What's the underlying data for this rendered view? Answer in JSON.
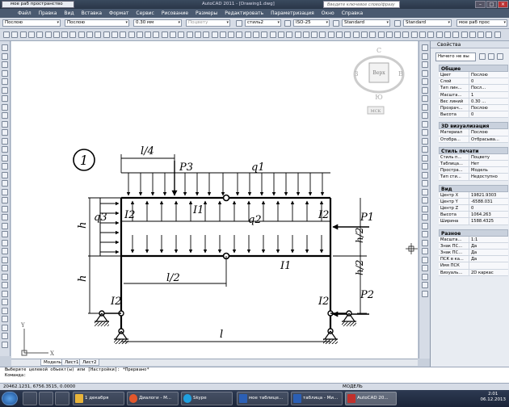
{
  "titlebar": {
    "workspace": "мое раб пространство",
    "title": "AutoCAD 2011 - [Drawing1.dwg]",
    "search_placeholder": "Введите ключевое слово/фразу"
  },
  "menu": [
    "Файл",
    "Правка",
    "Вид",
    "Вставка",
    "Формат",
    "Сервис",
    "Рисование",
    "Размеры",
    "Редактировать",
    "Параметризация",
    "Окно",
    "Справка"
  ],
  "toolbar1": {
    "color": "Послою",
    "linetype": "Послою",
    "lineweight": "0.30 мм",
    "plotstyle": "Поцвету",
    "textstyle": "стиль2",
    "dimstyle": "ISO-25",
    "tablestyle": "Standard",
    "mleaderstyle": "Standard",
    "workspace2": "мое раб прос"
  },
  "viewcube": {
    "north": "С",
    "south": "Ю",
    "west": "З",
    "east": "В",
    "top": "Верх",
    "ucs": "МСК"
  },
  "drawing": {
    "number": "1",
    "label_l4": "l/4",
    "label_P3": "P3",
    "label_q1": "q1",
    "label_q2": "q2",
    "label_q3": "q3",
    "label_I1a": "I1",
    "label_I1b": "I1",
    "label_I2tl": "I2",
    "label_I2tr": "I2",
    "label_I2bl": "I2",
    "label_I2br": "I2",
    "label_P1": "P1",
    "label_P2": "P2",
    "label_h1": "h",
    "label_h2": "h",
    "label_h2a": "h/2",
    "label_h2b": "h/2",
    "label_l2": "l/2",
    "label_l": "l",
    "axis_y": "Y",
    "axis_x": "X"
  },
  "tabs": [
    "Модель",
    "Лист1",
    "Лист2"
  ],
  "command": {
    "line1": "Выберите целевой объект(ы) или [Настройки]: *Прервано*",
    "line2": "Команда:"
  },
  "status": {
    "coords": "20462.1231, 6756.3515, 0.0000",
    "model": "МОДЕЛЬ"
  },
  "properties": {
    "header": "Свойства",
    "selection": "Ничего не вы",
    "sections": [
      {
        "title": "Общие",
        "rows": [
          [
            "Цвет",
            "Послою"
          ],
          [
            "Слой",
            "0"
          ],
          [
            "Тип лин...",
            "Посл..."
          ],
          [
            "Масшта...",
            "1"
          ],
          [
            "Вес линий",
            "0.30 ..."
          ],
          [
            "Прозрач...",
            "Послою"
          ],
          [
            "Высота",
            "0"
          ]
        ]
      },
      {
        "title": "3D визуализация",
        "rows": [
          [
            "Материал",
            "Послою"
          ],
          [
            "Отобра...",
            "Отбрасыва..."
          ]
        ]
      },
      {
        "title": "Стиль печати",
        "rows": [
          [
            "Стиль п...",
            "Поцвету"
          ],
          [
            "Таблица...",
            "Нет"
          ],
          [
            "Простра...",
            "Модель"
          ],
          [
            "Тип сти...",
            "Недоступно"
          ]
        ]
      },
      {
        "title": "Вид",
        "rows": [
          [
            "Центр X",
            "19821.9303"
          ],
          [
            "Центр Y",
            "-6588.031"
          ],
          [
            "Центр Z",
            "0"
          ],
          [
            "Высота",
            "1064.263"
          ],
          [
            "Ширина",
            "1588.4325"
          ]
        ]
      },
      {
        "title": "Разное",
        "rows": [
          [
            "Масшта...",
            "1:1"
          ],
          [
            "Знак ПС...",
            "Да"
          ],
          [
            "Знак ПС...",
            "Да"
          ],
          [
            "ПСК в ка...",
            "Да"
          ],
          [
            "Имя ПСК",
            ""
          ],
          [
            "Визуаль...",
            "2D каркас"
          ]
        ]
      }
    ]
  },
  "taskbar": {
    "items": [
      "1 декабря",
      "Диалоги - М...",
      "Skype",
      "мое таблице...",
      "таблица - Ми...",
      "AutoCAD 20..."
    ],
    "time": "2:01",
    "date": "06.12.2013"
  }
}
